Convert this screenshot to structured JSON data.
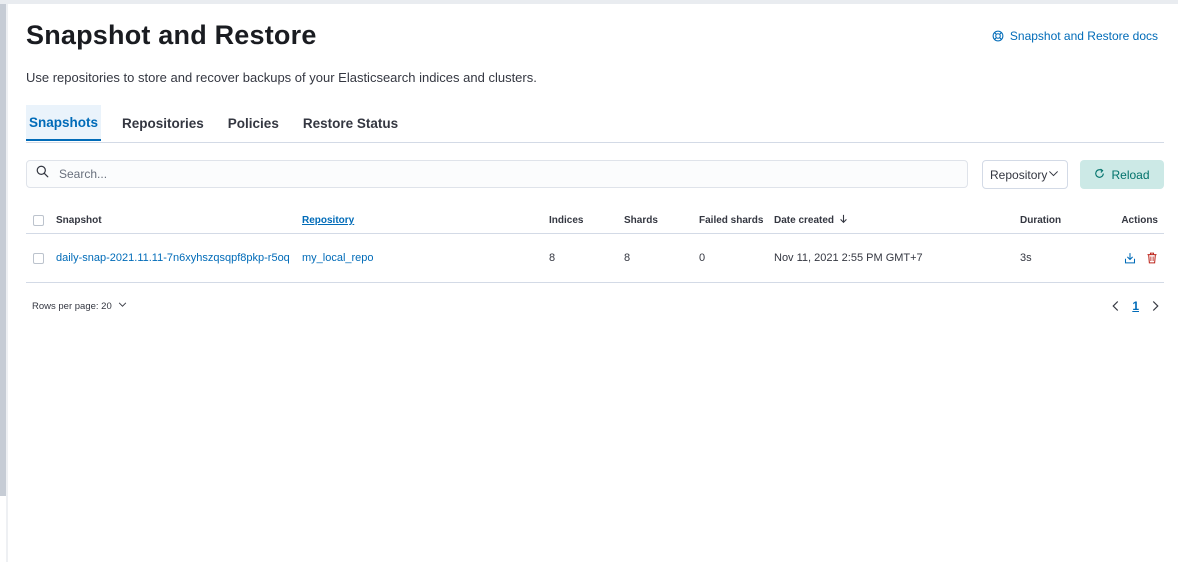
{
  "header": {
    "title": "Snapshot and Restore",
    "docs_link": "Snapshot and Restore docs",
    "description": "Use repositories to store and recover backups of your Elasticsearch indices and clusters."
  },
  "tabs": [
    {
      "label": "Snapshots",
      "active": true
    },
    {
      "label": "Repositories",
      "active": false
    },
    {
      "label": "Policies",
      "active": false
    },
    {
      "label": "Restore Status",
      "active": false
    }
  ],
  "toolbar": {
    "search_placeholder": "Search...",
    "repository_filter": "Repository",
    "reload_label": "Reload"
  },
  "table": {
    "columns": {
      "snapshot": "Snapshot",
      "repository": "Repository",
      "indices": "Indices",
      "shards": "Shards",
      "failed_shards": "Failed shards",
      "date_created": "Date created",
      "duration": "Duration",
      "actions": "Actions"
    },
    "rows": [
      {
        "snapshot": "daily-snap-2021.11.11-7n6xyhszqsqpf8pkp-r5oq",
        "repository": "my_local_repo",
        "indices": "8",
        "shards": "8",
        "failed_shards": "0",
        "date_created": "Nov 11, 2021 2:55 PM GMT+7",
        "duration": "3s"
      }
    ]
  },
  "pagination": {
    "rows_per_page": "Rows per page: 20",
    "current_page": "1"
  },
  "colors": {
    "accent": "#006bb8",
    "reload_bg": "#cce9e6",
    "reload_text": "#00726b",
    "delete": "#bd271e"
  },
  "icons": [
    "help-icon",
    "search-icon",
    "chevron-down-icon",
    "refresh-icon",
    "sort-arrow-down-icon",
    "restore-icon",
    "trash-icon",
    "arrow-left-icon",
    "arrow-right-icon"
  ]
}
